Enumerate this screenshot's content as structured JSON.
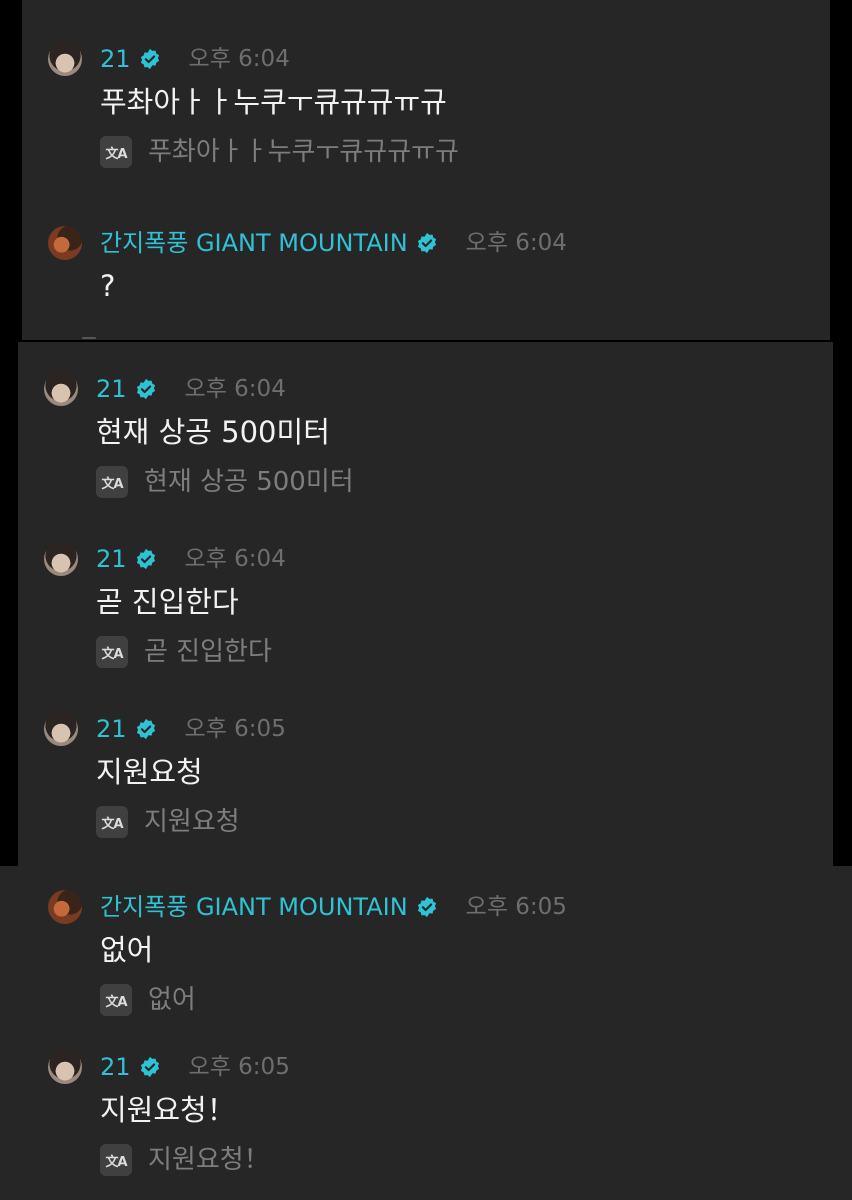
{
  "messages": [
    {
      "author": "21",
      "avatar": "21-avatar",
      "time": "오후 6:04",
      "text": "푸촤아ㅏㅏ누쿠ㅜ큐규규ㅠ규",
      "translation": "푸촤아ㅏㅏ누쿠ㅜ큐규규ㅠ규"
    },
    {
      "author": "간지폭풍 GIANT MOUNTAIN",
      "avatar": "giant-mountain-avatar",
      "time": "오후 6:04",
      "text": "?",
      "translation": ""
    },
    {
      "author": "21",
      "avatar": "21-avatar",
      "time": "오후 6:04",
      "text": "현재 상공 500미터",
      "translation": "현재 상공 500미터"
    },
    {
      "author": "21",
      "avatar": "21-avatar",
      "time": "오후 6:04",
      "text": "곧 진입한다",
      "translation": "곧 진입한다"
    },
    {
      "author": "21",
      "avatar": "21-avatar",
      "time": "오후 6:05",
      "text": "지원요청",
      "translation": "지원요청"
    },
    {
      "author": "간지폭풍 GIANT MOUNTAIN",
      "avatar": "giant-mountain-avatar",
      "time": "오후 6:05",
      "text": "없어",
      "translation": "없어"
    },
    {
      "author": "21",
      "avatar": "21-avatar",
      "time": "오후 6:05",
      "text": "지원요청！",
      "translation": "지원요청！"
    }
  ],
  "translate_icon": {
    "name": "translate-icon",
    "glyph": "文A"
  },
  "colors": {
    "background": "#000000",
    "panel": "#262626",
    "author_name": "#2fc2d4",
    "verified_badge": "#2fc2d4",
    "timestamp": "#6e6e6e",
    "message_text": "#f2f2f2",
    "translation_text": "#7d7d7d"
  }
}
